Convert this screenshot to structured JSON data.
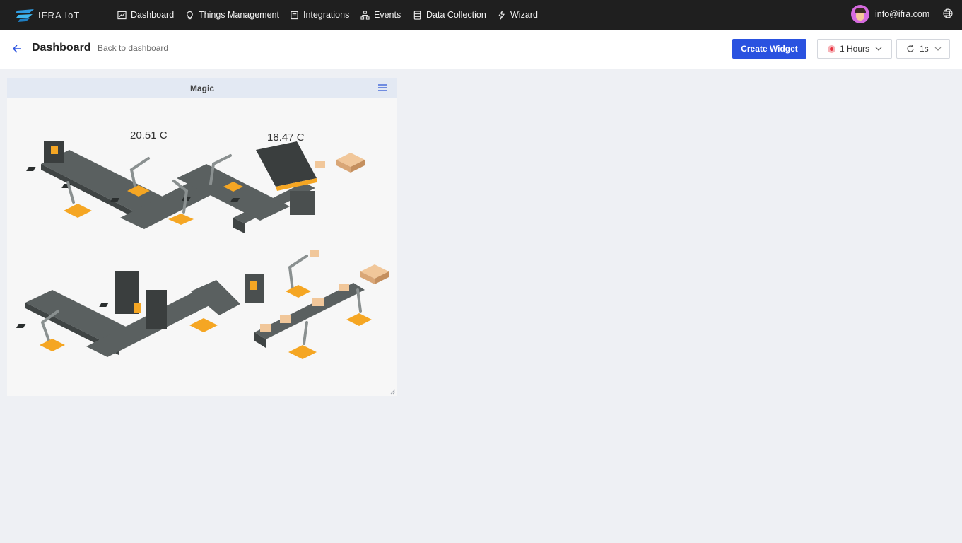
{
  "brand": {
    "name": "IFRA IoT"
  },
  "nav": {
    "items": [
      {
        "label": "Dashboard",
        "icon": "chart-icon"
      },
      {
        "label": "Things Management",
        "icon": "bulb-icon"
      },
      {
        "label": "Integrations",
        "icon": "integration-icon"
      },
      {
        "label": "Events",
        "icon": "sitemap-icon"
      },
      {
        "label": "Data Collection",
        "icon": "database-icon"
      },
      {
        "label": "Wizard",
        "icon": "bolt-icon"
      }
    ]
  },
  "user": {
    "email": "info@ifra.com",
    "avatar": "avatar-icon"
  },
  "header": {
    "title": "Dashboard",
    "back_link": "Back to dashboard",
    "create_widget": "Create Widget",
    "time_range": "1 Hours",
    "refresh_interval": "1s"
  },
  "widget": {
    "title": "Magic",
    "temperatures": [
      "20.51 C",
      "18.47 C"
    ]
  },
  "colors": {
    "topbar": "#1f1f1f",
    "primary": "#2a52e0",
    "widget_header": "#e3e9f3",
    "background": "#eef0f4",
    "machine_gray": "#5a6060",
    "accent_orange": "#f5a623"
  }
}
